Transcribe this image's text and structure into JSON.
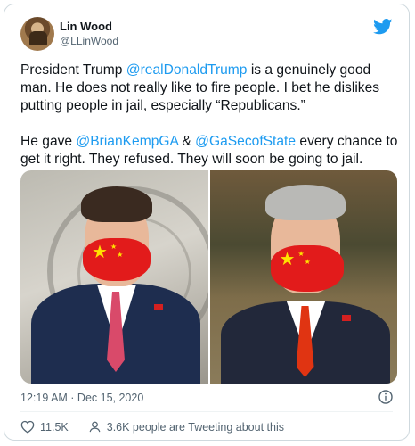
{
  "author": {
    "name": "Lin Wood",
    "handle": "@LLinWood"
  },
  "tweet": {
    "p1_a": "President Trump ",
    "p1_mention": "@realDonaldTrump",
    "p1_b": " is a genuinely good man. He does not really like to fire people. I bet he dislikes putting people in jail, especially “Republicans.”",
    "p2_a": "He gave ",
    "p2_mention1": "@BrianKempGA",
    "p2_b": " & ",
    "p2_mention2": "@GaSecofState",
    "p2_c": " every chance to get it right. They refused. They will soon be going to jail."
  },
  "timestamp": "12:19 AM · Dec 15, 2020",
  "stats": {
    "likes": "11.5K",
    "tweeting": "3.6K people are Tweeting about this"
  },
  "colors": {
    "accent": "#1d9bf0",
    "mask": "#e21b1b",
    "stars": "#ffe200"
  },
  "icons": [
    "twitter-bird-icon",
    "info-icon",
    "heart-icon",
    "person-icon"
  ]
}
